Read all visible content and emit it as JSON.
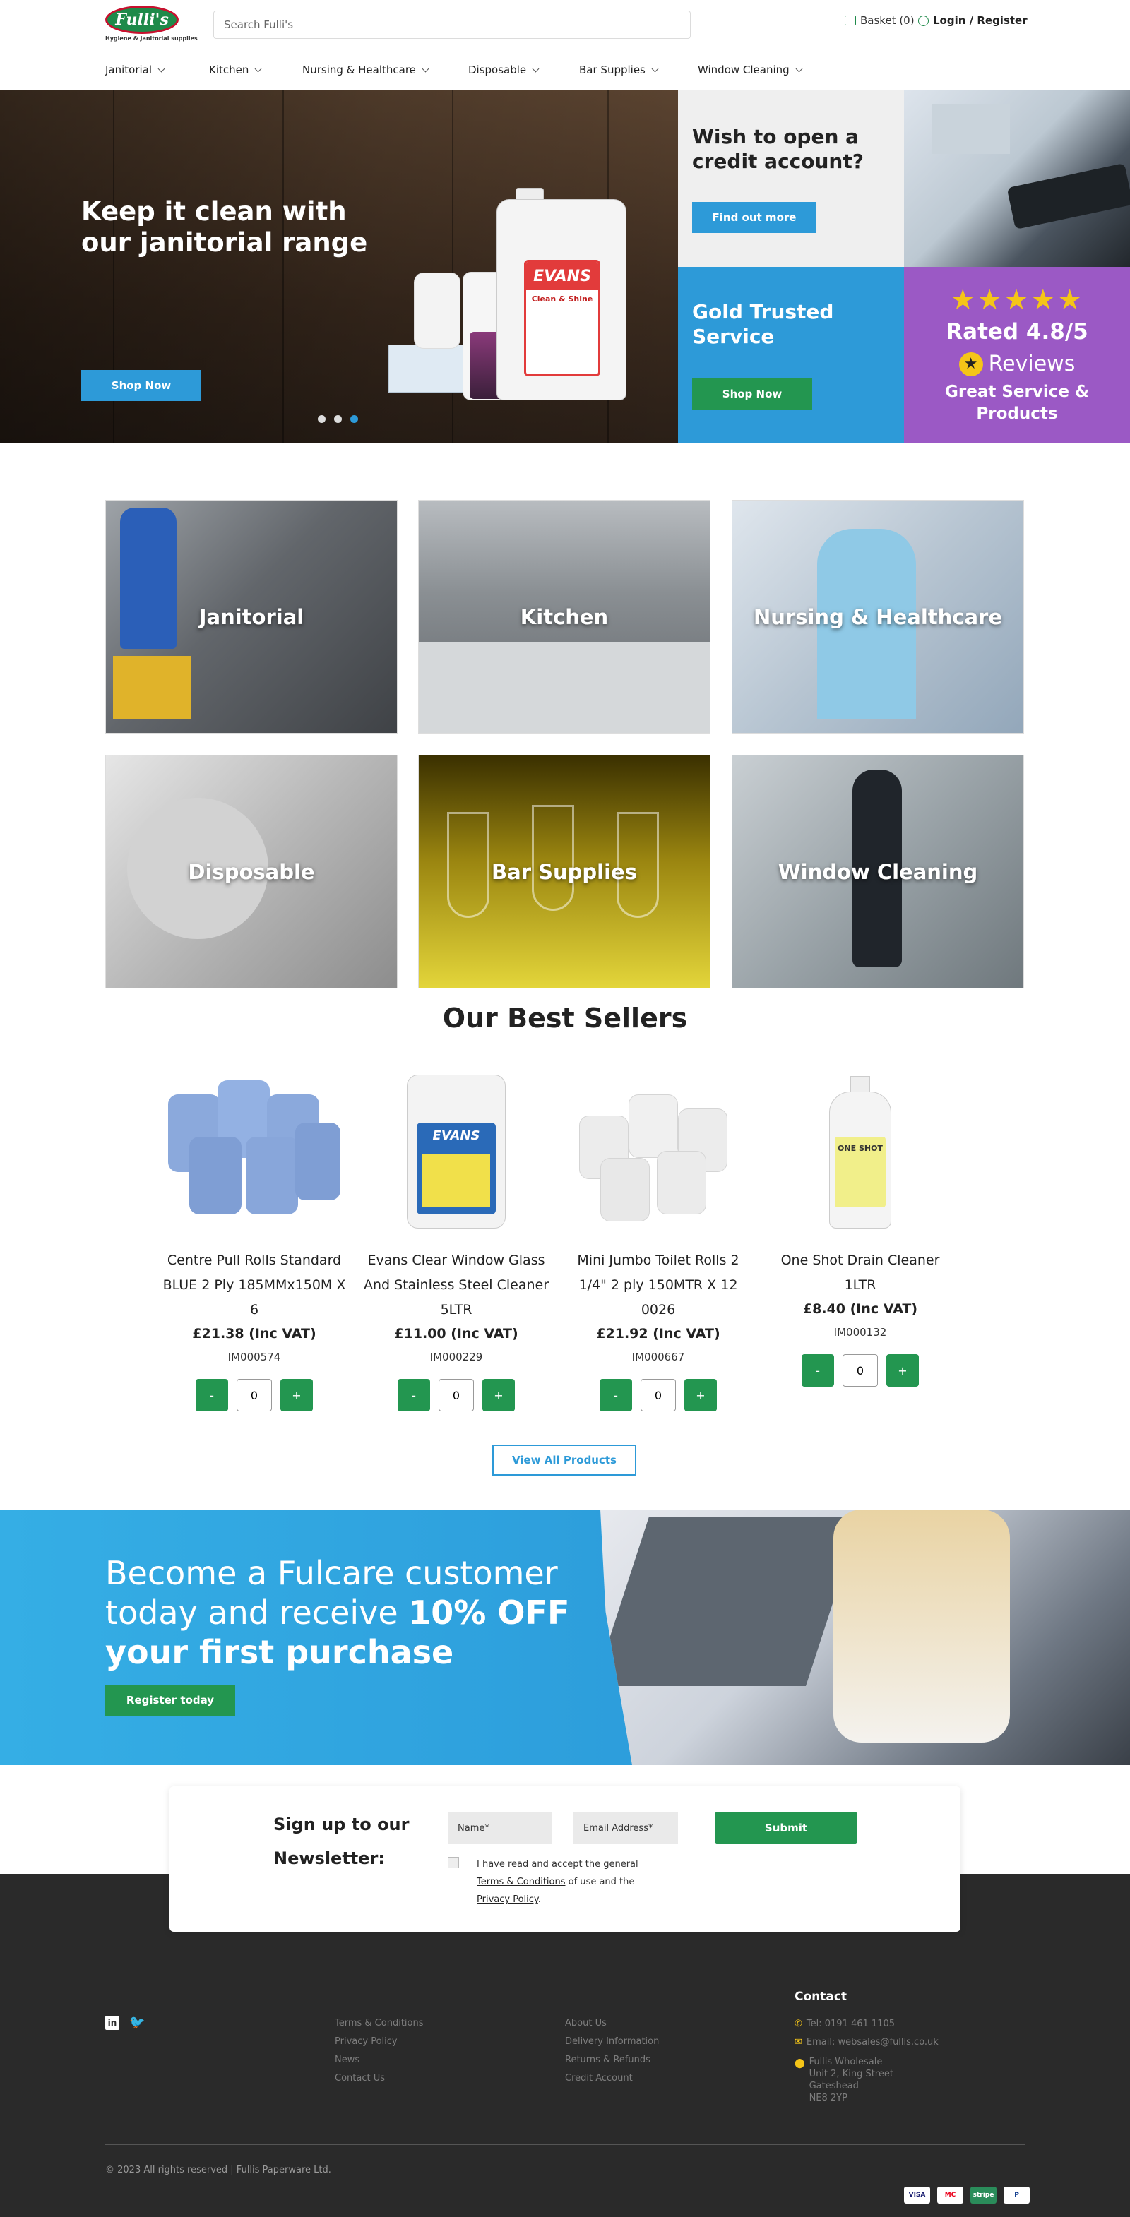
{
  "header": {
    "logo_text": "Fulli's",
    "logo_tagline": "Hygiene & Janitorial supplies",
    "search_placeholder": "Search Fulli's",
    "basket_label": "Basket (0)",
    "login_label": "Login / Register"
  },
  "nav": {
    "items": [
      {
        "label": "Janitorial"
      },
      {
        "label": "Kitchen"
      },
      {
        "label": "Nursing & Healthcare"
      },
      {
        "label": "Disposable"
      },
      {
        "label": "Bar Supplies"
      },
      {
        "label": "Window Cleaning"
      }
    ]
  },
  "hero": {
    "title": "Keep it clean with our janitorial range",
    "button": "Shop Now",
    "slides": 3,
    "active_slide": 3,
    "product_brand": "EVANS",
    "product_name": "Clean & Shine"
  },
  "promo": {
    "credit_title": "Wish to open a credit account?",
    "credit_button": "Find out more",
    "gold_title": "Gold Trusted Service",
    "gold_button": "Shop Now",
    "stars": "★★★★★",
    "rating_text": "Rated 4.8/5",
    "reviews_text": "Reviews",
    "rating_tagline": "Great Service & Products"
  },
  "categories": [
    {
      "label": "Janitorial",
      "color": "#6e6e70"
    },
    {
      "label": "Kitchen",
      "color": "#8c8f92"
    },
    {
      "label": "Nursing & Healthcare",
      "color": "#a7b5c3"
    },
    {
      "label": "Disposable",
      "color": "#a9a9a9"
    },
    {
      "label": "Bar Supplies",
      "color": "#8a7a10"
    },
    {
      "label": "Window Cleaning",
      "color": "#7f8b90"
    }
  ],
  "best_sellers": {
    "title": "Our Best Sellers",
    "products": [
      {
        "name": "Centre Pull Rolls Standard BLUE 2 Ply 185MMx150M X 6",
        "price": "£21.38 (Inc VAT)",
        "code": "IM000574",
        "qty": "0",
        "image_label": ""
      },
      {
        "name": "Evans Clear Window Glass And Stainless Steel Cleaner 5LTR",
        "price": "£11.00 (Inc VAT)",
        "code": "IM000229",
        "qty": "0",
        "image_label": "EVANS"
      },
      {
        "name": "Mini Jumbo Toilet Rolls 2 1/4\" 2 ply 150MTR X 12 0026",
        "price": "£21.92 (Inc VAT)",
        "code": "IM000667",
        "qty": "0",
        "image_label": ""
      },
      {
        "name": "One Shot Drain Cleaner 1LTR",
        "price": "£8.40 (Inc VAT)",
        "code": "IM000132",
        "qty": "0",
        "image_label": "ONE SHOT"
      }
    ],
    "minus": "-",
    "plus": "+",
    "view_all": "View All Products"
  },
  "register": {
    "title_plain": "Become a Fulcare customer today and receive ",
    "title_bold": "10% OFF your first purchase",
    "button": "Register today"
  },
  "newsletter": {
    "title": "Sign up to our Newsletter:",
    "name_placeholder": "Name*",
    "email_placeholder": "Email Address*",
    "submit": "Submit",
    "terms_prefix": "I have read and accept the general",
    "terms_link": "Terms & Conditions",
    "terms_mid": "of use and the",
    "privacy_link": "Privacy Policy",
    "terms_end": "."
  },
  "footer": {
    "col1": [
      "Terms & Conditions",
      "Privacy Policy",
      "News",
      "Contact Us"
    ],
    "col2": [
      "About Us",
      "Delivery Information",
      "Returns & Refunds",
      "Credit Account"
    ],
    "contact_title": "Contact",
    "tel": "Tel: 0191 461 1105",
    "email": "Email: websales@fullis.co.uk",
    "address": [
      "Fullis Wholesale",
      "Unit 2, King Street",
      "Gateshead",
      "NE8 2YP"
    ],
    "copyright": "© 2023 All rights reserved | Fullis Paperware Ltd.",
    "payments": [
      "VISA",
      "MC",
      "stripe",
      "P"
    ]
  },
  "colors": {
    "brand_green": "#239650",
    "brand_blue": "#2d9ad8",
    "brand_purple": "#9b59c5",
    "footer_bg": "#2a2a2a"
  }
}
